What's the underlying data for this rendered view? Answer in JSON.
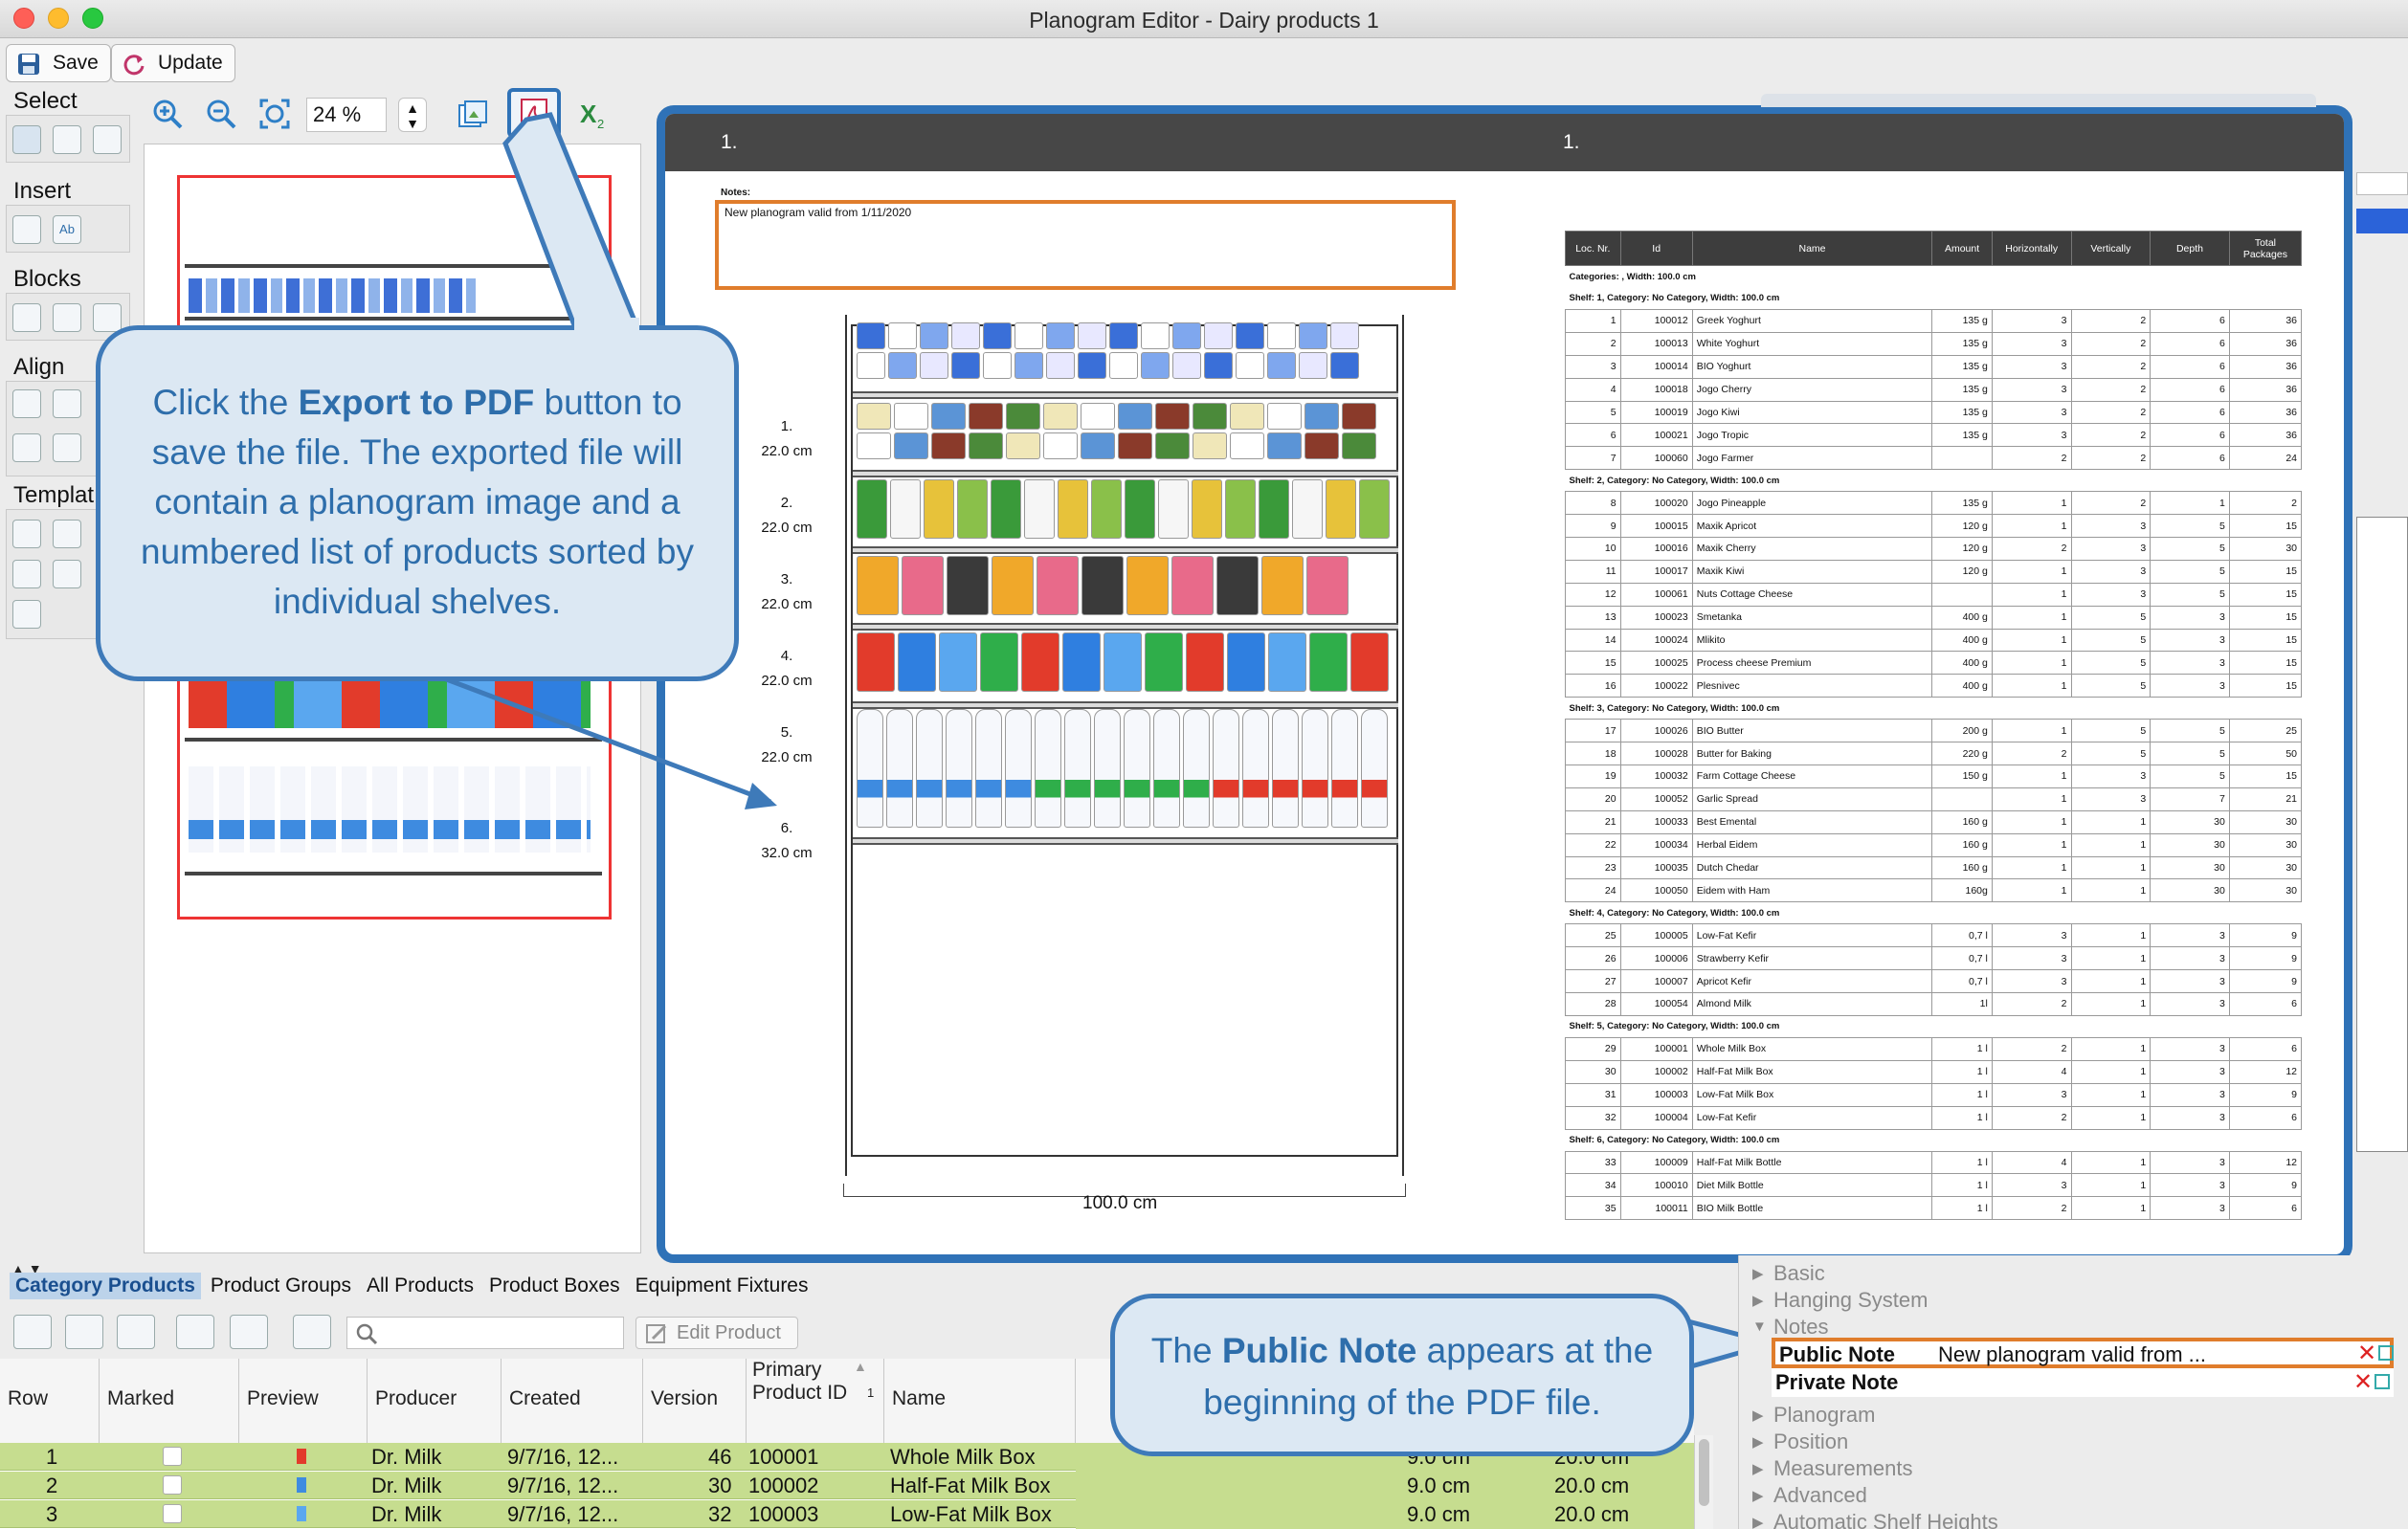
{
  "window": {
    "title": "Planogram Editor - Dairy products 1"
  },
  "toolbar": {
    "save": "Save",
    "update": "Update",
    "zoom": "24 %"
  },
  "palette": {
    "select": "Select",
    "insert": "Insert",
    "blocks": "Blocks",
    "align": "Align",
    "templates": "Templat",
    "insert_text_icon": "Ab"
  },
  "preview": {
    "header_left": "1.",
    "header_right": "1.",
    "notes_label": "Notes:",
    "notes_text": "New planogram valid from 1/11/2020",
    "shelves": [
      {
        "num": "1.",
        "height": "22.0 cm"
      },
      {
        "num": "2.",
        "height": "22.0 cm"
      },
      {
        "num": "3.",
        "height": "22.0 cm"
      },
      {
        "num": "4.",
        "height": "22.0 cm"
      },
      {
        "num": "5.",
        "height": "22.0 cm"
      },
      {
        "num": "6.",
        "height": "32.0 cm"
      }
    ],
    "width_label": "100.0 cm",
    "table": {
      "headers": [
        "Loc. Nr.",
        "Id",
        "Name",
        "Amount",
        "Horizontally",
        "Vertically",
        "Depth",
        "Total Packages"
      ],
      "categories_line": "Categories: , Width: 100.0 cm",
      "groups": [
        {
          "title": "Shelf: 1, Category: No Category, Width: 100.0 cm",
          "rows": [
            [
              "1",
              "100012",
              "Greek Yoghurt",
              "135 g",
              "3",
              "2",
              "6",
              "36"
            ],
            [
              "2",
              "100013",
              "White Yoghurt",
              "135 g",
              "3",
              "2",
              "6",
              "36"
            ],
            [
              "3",
              "100014",
              "BIO Yoghurt",
              "135 g",
              "3",
              "2",
              "6",
              "36"
            ],
            [
              "4",
              "100018",
              "Jogo Cherry",
              "135 g",
              "3",
              "2",
              "6",
              "36"
            ],
            [
              "5",
              "100019",
              "Jogo Kiwi",
              "135 g",
              "3",
              "2",
              "6",
              "36"
            ],
            [
              "6",
              "100021",
              "Jogo Tropic",
              "135 g",
              "3",
              "2",
              "6",
              "36"
            ],
            [
              "7",
              "100060",
              "Jogo Farmer",
              "",
              "2",
              "2",
              "6",
              "24"
            ]
          ]
        },
        {
          "title": "Shelf: 2, Category: No Category, Width: 100.0 cm",
          "rows": [
            [
              "8",
              "100020",
              "Jogo Pineapple",
              "135 g",
              "1",
              "2",
              "1",
              "2"
            ],
            [
              "9",
              "100015",
              "Maxik Apricot",
              "120 g",
              "1",
              "3",
              "5",
              "15"
            ],
            [
              "10",
              "100016",
              "Maxik Cherry",
              "120 g",
              "2",
              "3",
              "5",
              "30"
            ],
            [
              "11",
              "100017",
              "Maxik Kiwi",
              "120 g",
              "1",
              "3",
              "5",
              "15"
            ],
            [
              "12",
              "100061",
              "Nuts Cottage Cheese",
              "",
              "1",
              "3",
              "5",
              "15"
            ],
            [
              "13",
              "100023",
              "Smetanka",
              "400 g",
              "1",
              "5",
              "3",
              "15"
            ],
            [
              "14",
              "100024",
              "Mlikito",
              "400 g",
              "1",
              "5",
              "3",
              "15"
            ],
            [
              "15",
              "100025",
              "Process cheese Premium",
              "400 g",
              "1",
              "5",
              "3",
              "15"
            ],
            [
              "16",
              "100022",
              "Plesnivec",
              "400 g",
              "1",
              "5",
              "3",
              "15"
            ]
          ]
        },
        {
          "title": "Shelf: 3, Category: No Category, Width: 100.0 cm",
          "rows": [
            [
              "17",
              "100026",
              "BIO Butter",
              "200 g",
              "1",
              "5",
              "5",
              "25"
            ],
            [
              "18",
              "100028",
              "Butter for Baking",
              "220 g",
              "2",
              "5",
              "5",
              "50"
            ],
            [
              "19",
              "100032",
              "Farm Cottage Cheese",
              "150 g",
              "1",
              "3",
              "5",
              "15"
            ],
            [
              "20",
              "100052",
              "Garlic Spread",
              "",
              "1",
              "3",
              "7",
              "21"
            ],
            [
              "21",
              "100033",
              "Best Emental",
              "160 g",
              "1",
              "1",
              "30",
              "30"
            ],
            [
              "22",
              "100034",
              "Herbal Eidem",
              "160 g",
              "1",
              "1",
              "30",
              "30"
            ],
            [
              "23",
              "100035",
              "Dutch Chedar",
              "160 g",
              "1",
              "1",
              "30",
              "30"
            ],
            [
              "24",
              "100050",
              "Eidem with Ham",
              "160g",
              "1",
              "1",
              "30",
              "30"
            ]
          ]
        },
        {
          "title": "Shelf: 4, Category: No Category, Width: 100.0 cm",
          "rows": [
            [
              "25",
              "100005",
              "Low-Fat Kefir",
              "0,7 l",
              "3",
              "1",
              "3",
              "9"
            ],
            [
              "26",
              "100006",
              "Strawberry Kefir",
              "0,7 l",
              "3",
              "1",
              "3",
              "9"
            ],
            [
              "27",
              "100007",
              "Apricot Kefir",
              "0,7 l",
              "3",
              "1",
              "3",
              "9"
            ],
            [
              "28",
              "100054",
              "Almond Milk",
              "1l",
              "2",
              "1",
              "3",
              "6"
            ]
          ]
        },
        {
          "title": "Shelf: 5, Category: No Category, Width: 100.0 cm",
          "rows": [
            [
              "29",
              "100001",
              "Whole Milk Box",
              "1 l",
              "2",
              "1",
              "3",
              "6"
            ],
            [
              "30",
              "100002",
              "Half-Fat Milk Box",
              "1 l",
              "4",
              "1",
              "3",
              "12"
            ],
            [
              "31",
              "100003",
              "Low-Fat Milk Box",
              "1 l",
              "3",
              "1",
              "3",
              "9"
            ],
            [
              "32",
              "100004",
              "Low-Fat Kefir",
              "1 l",
              "2",
              "1",
              "3",
              "6"
            ]
          ]
        },
        {
          "title": "Shelf: 6, Category: No Category, Width: 100.0 cm",
          "rows": [
            [
              "33",
              "100009",
              "Half-Fat Milk Bottle",
              "1 l",
              "4",
              "1",
              "3",
              "12"
            ],
            [
              "34",
              "100010",
              "Diet Milk Bottle",
              "1 l",
              "3",
              "1",
              "3",
              "9"
            ],
            [
              "35",
              "100011",
              "BIO Milk Bottle",
              "1 l",
              "2",
              "1",
              "3",
              "6"
            ]
          ]
        }
      ]
    }
  },
  "callout_pdf": {
    "pre": "Click the ",
    "bold": "Export to PDF",
    "post": " button to save the file. The exported file will contain a planogram image and a numbered list of products sorted by individual shelves."
  },
  "callout_note": {
    "pre": "The ",
    "bold": "Public Note",
    "post": " appears at the beginning of the PDF file."
  },
  "bottom_tabs": [
    "Category Products",
    "Product Groups",
    "All Products",
    "Product Boxes",
    "Equipment Fixtures"
  ],
  "edit_product": "Edit Product",
  "grid": {
    "headers": [
      "Row",
      "Marked",
      "Preview",
      "Producer",
      "Created",
      "Version",
      "Primary Product ID",
      "Name"
    ],
    "sort_index": "1",
    "rows": [
      {
        "row": "1",
        "producer": "Dr. Milk",
        "created": "9/7/16, 12...",
        "version": "46",
        "id": "100001",
        "name": "Whole Milk Box",
        "w": "9.0 cm",
        "h": "20.0 cm"
      },
      {
        "row": "2",
        "producer": "Dr. Milk",
        "created": "9/7/16, 12...",
        "version": "30",
        "id": "100002",
        "name": "Half-Fat Milk Box",
        "w": "9.0 cm",
        "h": "20.0 cm"
      },
      {
        "row": "3",
        "producer": "Dr. Milk",
        "created": "9/7/16, 12...",
        "version": "32",
        "id": "100003",
        "name": "Low-Fat Milk Box",
        "w": "9.0 cm",
        "h": "20.0 cm"
      }
    ]
  },
  "properties": {
    "basic": "Basic",
    "hanging": "Hanging System",
    "notes": "Notes",
    "public_note": "Public Note",
    "public_note_value": "New planogram valid from ...",
    "private_note": "Private Note",
    "planogram": "Planogram",
    "position": "Position",
    "measurements": "Measurements",
    "advanced": "Advanced",
    "auto_shelf": "Automatic Shelf Heights"
  },
  "colors": {
    "accent": "#2f72b7",
    "callout_bg": "#dce8f3",
    "highlight": "#e07d2c",
    "grid_row": "#c6dd8f"
  }
}
